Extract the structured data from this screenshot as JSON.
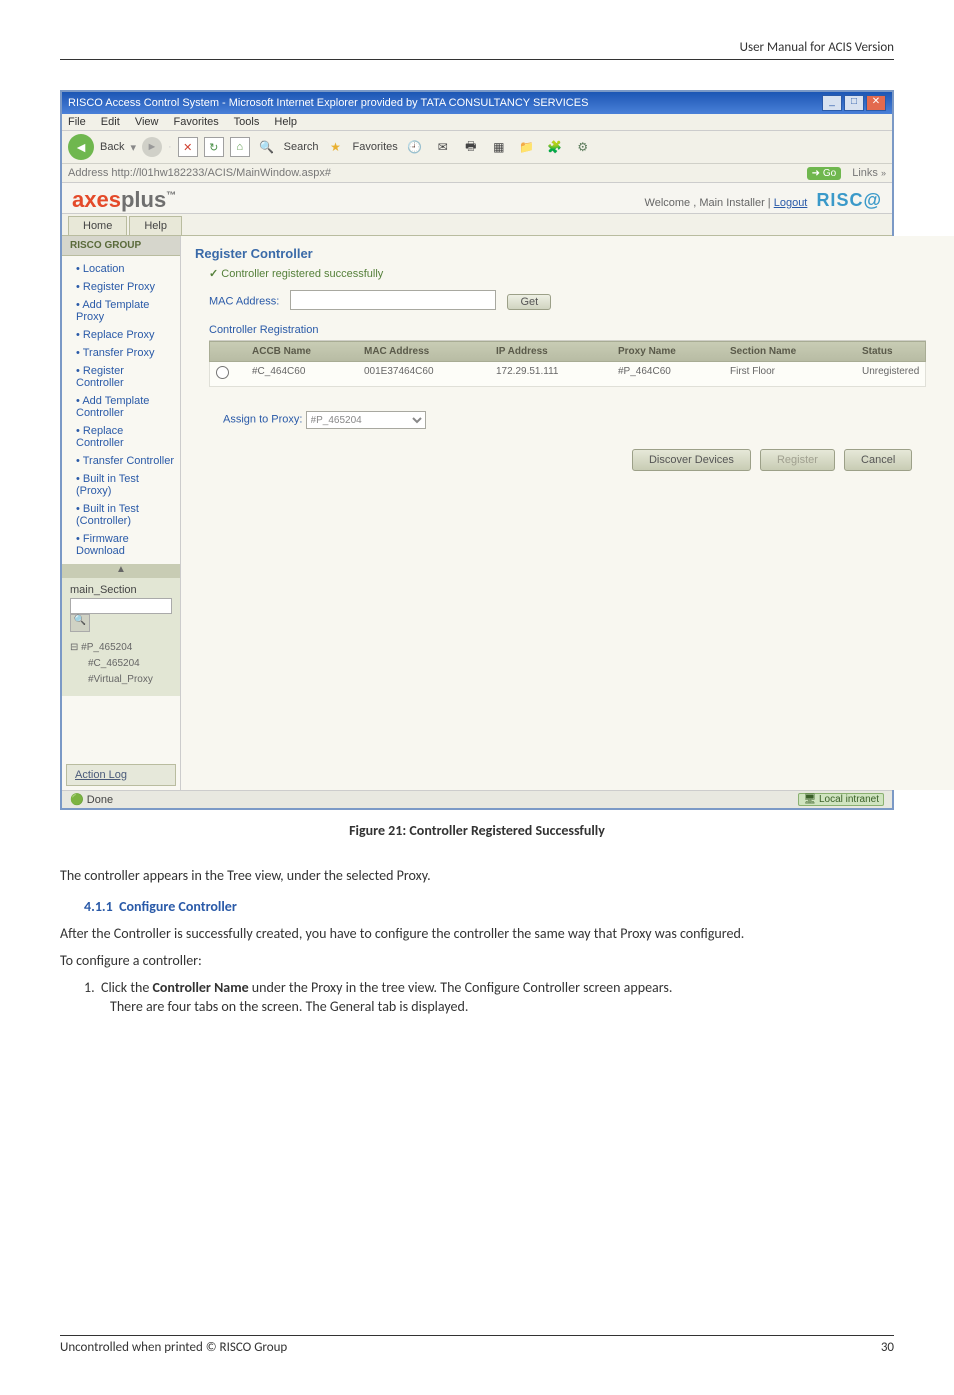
{
  "page_header": "User Manual for ACIS Version",
  "browser": {
    "title": "RISCO Access Control System - Microsoft Internet Explorer provided by TATA CONSULTANCY SERVICES",
    "menus": [
      "File",
      "Edit",
      "View",
      "Favorites",
      "Tools",
      "Help"
    ],
    "toolbar": {
      "back": "Back",
      "search": "Search",
      "favorites": "Favorites"
    },
    "address_label": "Address",
    "url": "http://l01hw182233/ACIS/MainWindow.aspx#",
    "go": "Go",
    "links": "Links"
  },
  "app": {
    "brand_axes": "axes",
    "brand_plus": "plus",
    "welcome_prefix": "Welcome , Main Installer | ",
    "logout": "Logout",
    "risco": "RISC@",
    "tabs": [
      "Home",
      "Help"
    ]
  },
  "sidebar": {
    "group": "RISCO GROUP",
    "items": [
      "Location",
      "Register Proxy",
      "Add Template Proxy",
      "Replace Proxy",
      "Transfer Proxy",
      "Register Controller",
      "Add Template Controller",
      "Replace Controller",
      "Transfer Controller",
      "Built in Test (Proxy)",
      "Built in Test (Controller)",
      "Firmware Download"
    ],
    "tree_title_arrow": "▲",
    "tree": {
      "root": "main_Section",
      "node1": "⊟ #P_465204",
      "node2": "#C_465204",
      "node3": "#Virtual_Proxy"
    },
    "action_log": "Action Log"
  },
  "main": {
    "title": "Register Controller",
    "success": "Controller registered successfully",
    "mac_label": "MAC Address:",
    "get": "Get",
    "fieldset_label": "Controller Registration",
    "headers": {
      "accb": "ACCB Name",
      "mac": "MAC Address",
      "ip": "IP Address",
      "proxy": "Proxy Name",
      "section": "Section Name",
      "status": "Status"
    },
    "row": {
      "accb": "#C_464C60",
      "mac": "001E37464C60",
      "ip": "172.29.51.111",
      "proxy": "#P_464C60",
      "section": "First Floor",
      "status": "Unregistered"
    },
    "assign_label": "Assign to Proxy:",
    "assign_value": "#P_465204",
    "buttons": {
      "discover": "Discover Devices",
      "register": "Register",
      "cancel": "Cancel"
    }
  },
  "statusbar": {
    "done": "Done",
    "zone": "Local intranet"
  },
  "figure_caption": "Figure 21: Controller Registered Successfully",
  "body": {
    "p1": "The controller appears in the Tree view, under the selected Proxy.",
    "section_num": "4.1.1",
    "section_title": "Configure Controller",
    "p2": "After the Controller is successfully created, you have to configure the controller the same way that Proxy was configured.",
    "p3": "To configure a controller:",
    "step_num": "1.",
    "step1a": "Click the ",
    "step1b": "Controller Name",
    "step1c": " under the Proxy in the tree view. The Configure Controller screen appears.",
    "step1_sub": "There are four tabs on the screen. The General tab is displayed."
  },
  "footer": {
    "left": "Uncontrolled when printed © RISCO Group",
    "right": "30"
  }
}
